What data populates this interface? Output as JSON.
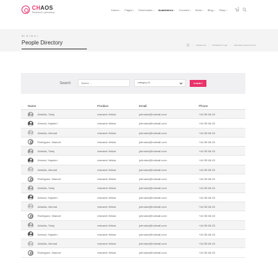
{
  "brand": {
    "title_accent": "CH",
    "title_rest": "AOS",
    "subtitle": "Research Laboratory"
  },
  "nav": [
    {
      "label": "Home",
      "active": false
    },
    {
      "label": "Pages",
      "active": false
    },
    {
      "label": "Shortcodes",
      "active": false
    },
    {
      "label": "Academics",
      "active": true
    },
    {
      "label": "Courses",
      "active": false
    },
    {
      "label": "Work",
      "active": false
    },
    {
      "label": "Blog",
      "active": false
    },
    {
      "label": "Shop",
      "active": false
    }
  ],
  "header": {
    "cart_count": "0"
  },
  "title_bar": {
    "kicker": "MINIMAL",
    "title": "People Directory",
    "breadcrumb": [
      "Academics",
      "Publication Type",
      "Laboratory Environment"
    ]
  },
  "search": {
    "label": "Search",
    "placeholder": "Search ...",
    "category_value": "category #1",
    "submit_label": "SUBMIT"
  },
  "table": {
    "headers": [
      "Name",
      "Position",
      "Email",
      "Phone"
    ],
    "rows": [
      {
        "name": "Abdulla, Tariq",
        "position": "research fellow",
        "email": "johndoe@hotmail.com",
        "phone": "+44 55 66 43",
        "avatar": "photo"
      },
      {
        "name": "Ahmad, Hayden",
        "position": "research fellow",
        "email": "johndoe@hotmail.com",
        "phone": "+44 55 66 43",
        "avatar": "photo-dark"
      },
      {
        "name": "Abdulla, Ahmad",
        "position": "research fellow",
        "email": "johndoe@hotmail.com",
        "phone": "+44 55 66 43",
        "avatar": "photo-light"
      },
      {
        "name": "Rodriguez, Manuel",
        "position": "research fellow",
        "email": "johndoe@hotmail.com",
        "phone": "+44 55 66 43",
        "avatar": "outline"
      },
      {
        "name": "Abdulla, Tariq",
        "position": "research fellow",
        "email": "johndoe@hotmail.com",
        "phone": "+44 55 66 43",
        "avatar": "photo"
      },
      {
        "name": "Ahmad, Hayden",
        "position": "research fellow",
        "email": "johndoe@hotmail.com",
        "phone": "+44 55 66 43",
        "avatar": "photo-dark"
      },
      {
        "name": "Abdulla, Ahmad",
        "position": "research fellow",
        "email": "johndoe@hotmail.com",
        "phone": "+44 55 66 43",
        "avatar": "photo-light"
      },
      {
        "name": "Rodriguez, Manuel",
        "position": "research fellow",
        "email": "johndoe@hotmail.com",
        "phone": "+44 55 66 43",
        "avatar": "outline"
      },
      {
        "name": "Abdulla, Tariq",
        "position": "research fellow",
        "email": "johndoe@hotmail.com",
        "phone": "+44 55 66 43",
        "avatar": "photo"
      },
      {
        "name": "Ahmad, Hayden",
        "position": "research fellow",
        "email": "johndoe@hotmail.com",
        "phone": "+44 55 66 43",
        "avatar": "photo-dark"
      },
      {
        "name": "Abdulla, Ahmad",
        "position": "research fellow",
        "email": "johndoe@hotmail.com",
        "phone": "+44 55 66 43",
        "avatar": "photo-light"
      },
      {
        "name": "Rodriguez, Manuel",
        "position": "research fellow",
        "email": "johndoe@hotmail.com",
        "phone": "+44 55 66 43",
        "avatar": "outline"
      },
      {
        "name": "Abdulla, Tariq",
        "position": "research fellow",
        "email": "johndoe@hotmail.com",
        "phone": "+44 55 66 43",
        "avatar": "photo"
      },
      {
        "name": "Ahmad, Hayden",
        "position": "research fellow",
        "email": "johndoe@hotmail.com",
        "phone": "+44 55 66 43",
        "avatar": "photo-dark"
      },
      {
        "name": "Abdulla, Ahmad",
        "position": "research fellow",
        "email": "johndoe@hotmail.com",
        "phone": "+44 55 66 43",
        "avatar": "photo-light"
      },
      {
        "name": "Rodriguez, Manuel",
        "position": "research fellow",
        "email": "johndoe@hotmail.com",
        "phone": "+44 55 66 43",
        "avatar": "outline"
      }
    ]
  },
  "colors": {
    "accent": "#e8336a",
    "panel": "#f0f0f2",
    "title_bar": "#f4f4f5"
  },
  "icons": {
    "logo": "logo-icon",
    "cart": "cart-icon",
    "search": "search-icon",
    "home": "home-icon"
  }
}
